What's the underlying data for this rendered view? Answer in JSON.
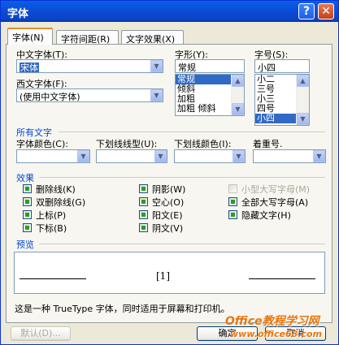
{
  "window": {
    "title": "字体",
    "help_glyph": "?",
    "close_glyph": "✕"
  },
  "tabs": [
    {
      "label": "字体(N)",
      "active": true
    },
    {
      "label": "字符间距(R)",
      "active": false
    },
    {
      "label": "文字效果(X)",
      "active": false
    }
  ],
  "font": {
    "chinese_label": "中文字体(T):",
    "chinese_value": "宋体",
    "western_label": "西文字体(F):",
    "western_value": "(使用中文字体)",
    "style_label": "字形(Y):",
    "style_value": "常规",
    "style_options": [
      "常规",
      "倾斜",
      "加粗",
      "加粗 倾斜"
    ],
    "size_label": "字号(S):",
    "size_value": "小四",
    "size_options": [
      "小二",
      "三号",
      "小三",
      "四号",
      "小四"
    ]
  },
  "all_text": {
    "section_label": "所有文字",
    "color_label": "字体颜色(C):",
    "underline_type_label": "下划线线型(U):",
    "underline_color_label": "下划线颜色(I):",
    "emphasis_label": "着重号."
  },
  "effects": {
    "section_label": "效果",
    "col1": [
      "删除线(K)",
      "双删除线(G)",
      "上标(P)",
      "下标(B)"
    ],
    "col2": [
      "阴影(W)",
      "空心(O)",
      "阳文(E)",
      "阴文(V)"
    ],
    "col3": [
      "小型大写字母(M)",
      "全部大写字母(A)",
      "隐藏文字(H)"
    ]
  },
  "preview": {
    "section_label": "预览",
    "sample": "[1]",
    "description": "这是一种 TrueType 字体，同时适用于屏幕和打印机。"
  },
  "buttons": {
    "default": "默认(D)...",
    "ok": "确定",
    "cancel": "取消"
  },
  "watermark": {
    "brand": "Office教程学习网",
    "url": "www.office68.com"
  },
  "colors": {
    "accent": "#316ac5",
    "title_bar": "#0a4fd8",
    "section": "#0046d5"
  }
}
